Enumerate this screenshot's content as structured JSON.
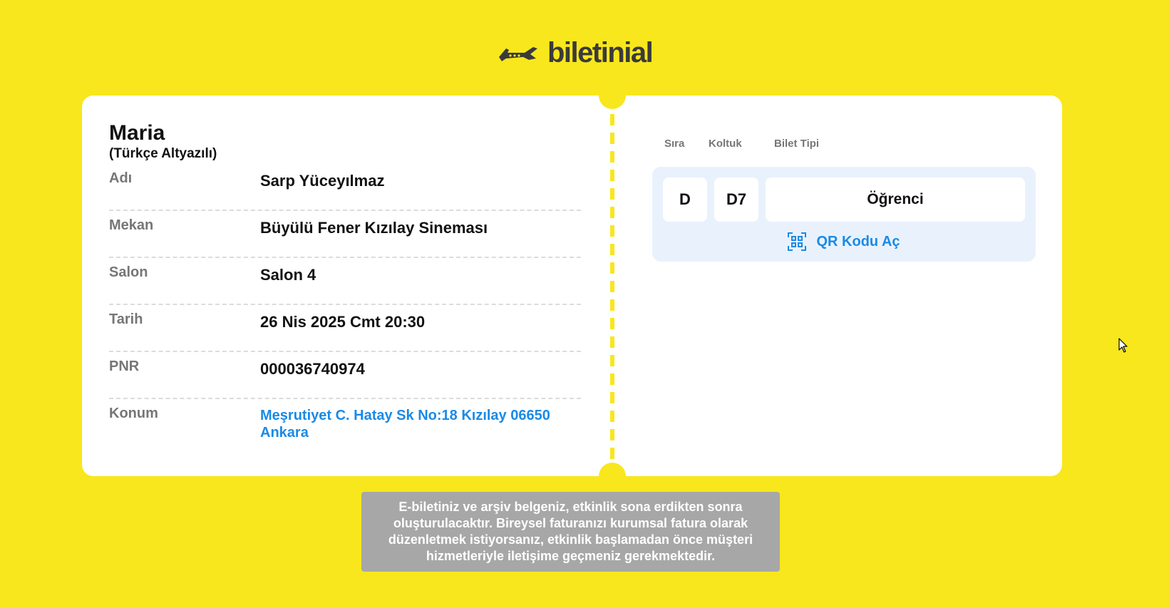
{
  "brand": {
    "name": "biletinial",
    "icon": "plane-ticket-logo-icon",
    "background_color": "#f8e71c"
  },
  "ticket": {
    "event_title": "Maria",
    "event_subtitle": "(Türkçe Altyazılı)",
    "details": [
      {
        "label": "Adı",
        "value": "Sarp Yüceyılmaz"
      },
      {
        "label": "Mekan",
        "value": "Büyülü Fener Kızılay Sineması"
      },
      {
        "label": "Salon",
        "value": "Salon 4"
      },
      {
        "label": "Tarih",
        "value": "26 Nis 2025 Cmt 20:30"
      },
      {
        "label": "PNR",
        "value": "000036740974"
      }
    ],
    "location": {
      "label": "Konum",
      "value": "Meşrutiyet C. Hatay Sk No:18 Kızılay 06650 Ankara"
    },
    "seat": {
      "headers": {
        "row": "Sıra",
        "seat": "Koltuk",
        "type": "Bilet Tipi"
      },
      "row": "D",
      "seat": "D7",
      "type": "Öğrenci"
    },
    "qr_button": {
      "label": "QR Kodu Aç",
      "icon": "qr-code-icon"
    },
    "link_color": "#1a8ae6"
  },
  "notice": "E-biletiniz ve arşiv belgeniz, etkinlik sona erdikten sonra oluşturulacaktır. Bireysel faturanızı kurumsal fatura olarak düzenletmek istiyorsanız, etkinlik başlamadan önce müşteri hizmetleriyle iletişime geçmeniz gerekmektedir."
}
